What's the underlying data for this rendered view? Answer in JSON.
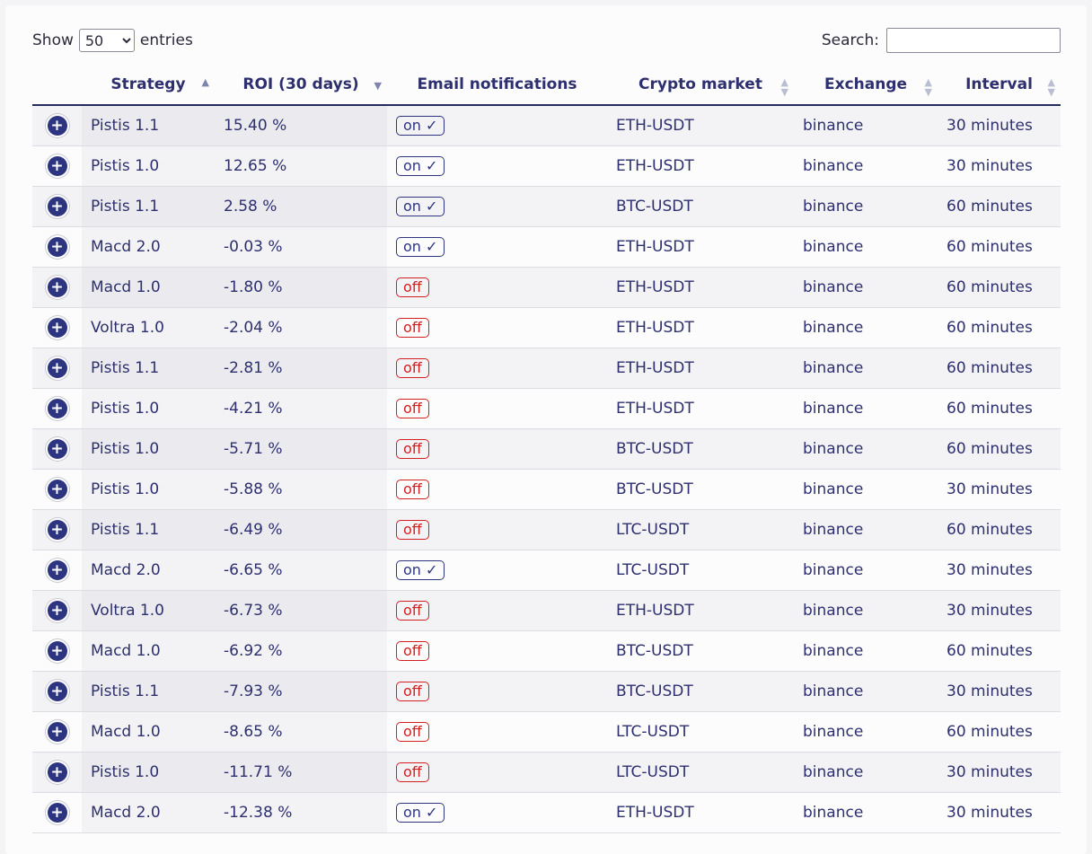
{
  "controls": {
    "show_label": "Show",
    "entries_value": "50",
    "entries_label": "entries",
    "search_label": "Search:",
    "search_value": ""
  },
  "columns": [
    "Strategy",
    "ROI (30 days)",
    "Email notifications",
    "Crypto market",
    "Exchange",
    "Interval"
  ],
  "rows": [
    {
      "strategy": "Pistis 1.1",
      "roi": "15.40 %",
      "email": "on ✓",
      "market": "ETH-USDT",
      "exchange": "binance",
      "interval": "30 minutes"
    },
    {
      "strategy": "Pistis 1.0",
      "roi": "12.65 %",
      "email": "on ✓",
      "market": "ETH-USDT",
      "exchange": "binance",
      "interval": "30 minutes"
    },
    {
      "strategy": "Pistis 1.1",
      "roi": "2.58 %",
      "email": "on ✓",
      "market": "BTC-USDT",
      "exchange": "binance",
      "interval": "60 minutes"
    },
    {
      "strategy": "Macd 2.0",
      "roi": "-0.03 %",
      "email": "on ✓",
      "market": "ETH-USDT",
      "exchange": "binance",
      "interval": "60 minutes"
    },
    {
      "strategy": "Macd 1.0",
      "roi": "-1.80 %",
      "email": "off",
      "market": "ETH-USDT",
      "exchange": "binance",
      "interval": "60 minutes"
    },
    {
      "strategy": "Voltra 1.0",
      "roi": "-2.04 %",
      "email": "off",
      "market": "ETH-USDT",
      "exchange": "binance",
      "interval": "60 minutes"
    },
    {
      "strategy": "Pistis 1.1",
      "roi": "-2.81 %",
      "email": "off",
      "market": "ETH-USDT",
      "exchange": "binance",
      "interval": "60 minutes"
    },
    {
      "strategy": "Pistis 1.0",
      "roi": "-4.21 %",
      "email": "off",
      "market": "ETH-USDT",
      "exchange": "binance",
      "interval": "60 minutes"
    },
    {
      "strategy": "Pistis 1.0",
      "roi": "-5.71 %",
      "email": "off",
      "market": "BTC-USDT",
      "exchange": "binance",
      "interval": "60 minutes"
    },
    {
      "strategy": "Pistis 1.0",
      "roi": "-5.88 %",
      "email": "off",
      "market": "BTC-USDT",
      "exchange": "binance",
      "interval": "30 minutes"
    },
    {
      "strategy": "Pistis 1.1",
      "roi": "-6.49 %",
      "email": "off",
      "market": "LTC-USDT",
      "exchange": "binance",
      "interval": "60 minutes"
    },
    {
      "strategy": "Macd 2.0",
      "roi": "-6.65 %",
      "email": "on ✓",
      "market": "LTC-USDT",
      "exchange": "binance",
      "interval": "30 minutes"
    },
    {
      "strategy": "Voltra 1.0",
      "roi": "-6.73 %",
      "email": "off",
      "market": "ETH-USDT",
      "exchange": "binance",
      "interval": "30 minutes"
    },
    {
      "strategy": "Macd 1.0",
      "roi": "-6.92 %",
      "email": "off",
      "market": "BTC-USDT",
      "exchange": "binance",
      "interval": "60 minutes"
    },
    {
      "strategy": "Pistis 1.1",
      "roi": "-7.93 %",
      "email": "off",
      "market": "BTC-USDT",
      "exchange": "binance",
      "interval": "30 minutes"
    },
    {
      "strategy": "Macd 1.0",
      "roi": "-8.65 %",
      "email": "off",
      "market": "LTC-USDT",
      "exchange": "binance",
      "interval": "60 minutes"
    },
    {
      "strategy": "Pistis 1.0",
      "roi": "-11.71 %",
      "email": "off",
      "market": "LTC-USDT",
      "exchange": "binance",
      "interval": "30 minutes"
    },
    {
      "strategy": "Macd 2.0",
      "roi": "-12.38 %",
      "email": "on ✓",
      "market": "ETH-USDT",
      "exchange": "binance",
      "interval": "30 minutes"
    }
  ],
  "icons": {
    "expand": "plus-circle-icon",
    "sort_asc": "sort-ascending-icon",
    "sort_desc": "sort-descending-icon",
    "sort_both": "sort-both-icon"
  },
  "colors": {
    "primary": "#2d3480",
    "on": "#2d3480",
    "off": "#d02020"
  }
}
